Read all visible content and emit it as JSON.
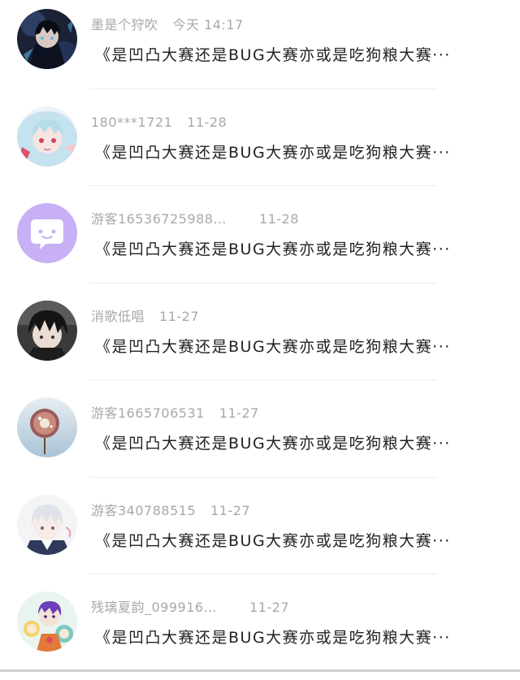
{
  "messages": [
    {
      "name": "墨是个狩吹",
      "time": "今天 14:17",
      "preview": "《是凹凸大赛还是BUG大赛亦或是吃狗粮大赛···",
      "avatar_icon": "dark-anime-character-avatar"
    },
    {
      "name": "180***1721",
      "time": "11-28",
      "preview": "《是凹凸大赛还是BUG大赛亦或是吃狗粮大赛···",
      "avatar_icon": "pastel-anime-girl-avatar"
    },
    {
      "name": "游客16536725988…",
      "time": "11-28",
      "preview": "《是凹凸大赛还是BUG大赛亦或是吃狗粮大赛···",
      "avatar_icon": "default-chat-bubble-avatar"
    },
    {
      "name": "消歌低唱",
      "time": "11-27",
      "preview": "《是凹凸大赛还是BUG大赛亦或是吃狗粮大赛···",
      "avatar_icon": "dark-haired-anime-boy-avatar"
    },
    {
      "name": "游客1665706531",
      "time": "11-27",
      "preview": "《是凹凸大赛还是BUG大赛亦或是吃狗粮大赛···",
      "avatar_icon": "paper-fan-avatar"
    },
    {
      "name": "游客340788515",
      "time": "11-27",
      "preview": "《是凹凸大赛还是BUG大赛亦或是吃狗粮大赛···",
      "avatar_icon": "white-haired-anime-boy-avatar"
    },
    {
      "name": "残璃夏韵_099916…",
      "time": "11-27",
      "preview": "《是凹凸大赛还是BUG大赛亦或是吃狗粮大赛···",
      "avatar_icon": "colorful-anime-group-avatar"
    }
  ],
  "colors": {
    "meta_text": "#a8a8a8",
    "preview_text": "#222222",
    "separator": "#ededed",
    "default_avatar_bg": "#c7b0f5"
  }
}
